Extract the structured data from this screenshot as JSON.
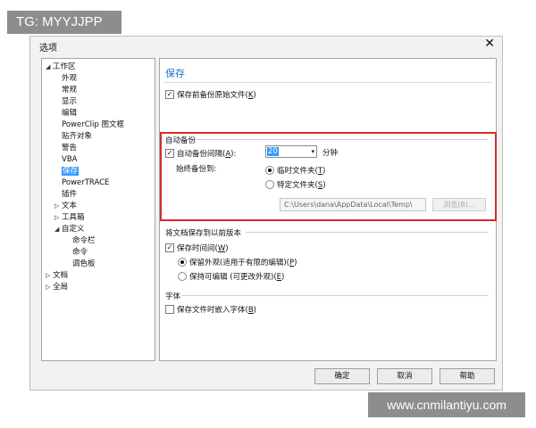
{
  "watermark_top": "TG: MYYJJPP",
  "watermark_bottom": "www.cnmilantiyu.com",
  "dialog": {
    "title": "选项",
    "close_glyph": "✕"
  },
  "tree": {
    "expanded_glyph": "◢",
    "collapsed_glyph": "▷",
    "items": [
      {
        "label": "工作区"
      },
      {
        "label": "外观"
      },
      {
        "label": "常规"
      },
      {
        "label": "显示"
      },
      {
        "label": "编辑"
      },
      {
        "label": "PowerClip 图文框"
      },
      {
        "label": "贴齐对象"
      },
      {
        "label": "警告"
      },
      {
        "label": "VBA"
      },
      {
        "label": "保存"
      },
      {
        "label": "PowerTRACE"
      },
      {
        "label": "插件"
      },
      {
        "label": "文本"
      },
      {
        "label": "工具箱"
      },
      {
        "label": "自定义"
      },
      {
        "label": "命令栏"
      },
      {
        "label": "命令"
      },
      {
        "label": "调色板"
      },
      {
        "label": "文档"
      },
      {
        "label": "全局"
      }
    ]
  },
  "panel": {
    "title": "保存",
    "backup_before_save": {
      "label": "保存前备份原始文件(",
      "key": "K",
      "end": ")",
      "checked": true
    },
    "auto_backup": {
      "group_label": "自动备份",
      "interval_check": {
        "label": "自动备份间隔(",
        "key": "A",
        "end": "):",
        "checked": true
      },
      "interval_value": "20",
      "interval_arrow": "▾",
      "interval_unit": "分钟",
      "always_backup_to": "始终备份到:",
      "radio_temp": {
        "label": "临时文件夹(",
        "key": "T",
        "end": ")",
        "selected": true
      },
      "radio_specific": {
        "label": "特定文件夹(",
        "key": "S",
        "end": ")",
        "selected": false
      },
      "path_value": "C:\\Users\\dana\\AppData\\Local\\Temp\\",
      "browse_label": "浏览(B)..."
    },
    "save_old_version": {
      "group_label": "将文档保存到以前版本",
      "save_time": {
        "label": "保存时间间(",
        "key": "W",
        "end": ")",
        "checked": true
      },
      "radio_keep_look": {
        "label": "保留外观(适用于有限的编辑)(",
        "key": "P",
        "end": ")",
        "selected": true
      },
      "radio_keep_edit": {
        "label": "保持可编辑 (可更改外观)(",
        "key": "E",
        "end": ")",
        "selected": false
      }
    },
    "fonts": {
      "group_label": "字体",
      "embed": {
        "label": "保存文件时嵌入字体(",
        "key": "B",
        "end": ")",
        "checked": false
      }
    }
  },
  "buttons": {
    "ok": "确定",
    "cancel": "取消",
    "help": "帮助"
  },
  "check_glyph": "✓"
}
